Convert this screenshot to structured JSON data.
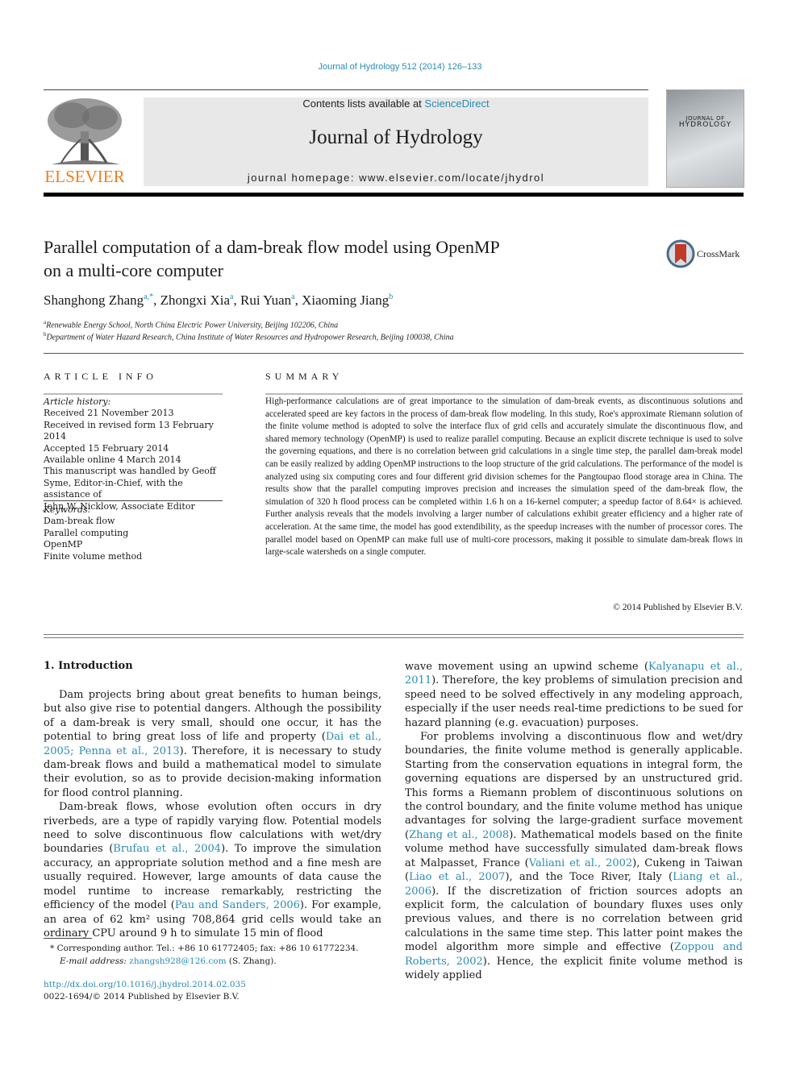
{
  "header": {
    "journal_ref": "Journal of Hydrology 512 (2014) 126–133",
    "contents_prefix": "Contents lists available at ",
    "contents_link": "ScienceDirect",
    "journal_title": "Journal of Hydrology",
    "homepage": "journal homepage: www.elsevier.com/locate/jhydrol",
    "publisher_logo_text": "ELSEVIER",
    "cover_line1": "JOURNAL OF",
    "cover_line2": "HYDROLOGY",
    "accent_color": "#2a8bb5",
    "publisher_color": "#f07f1e"
  },
  "article": {
    "title_line1": "Parallel computation of a dam-break flow model using OpenMP",
    "title_line2": "on a multi-core computer",
    "crossmark_label": "CrossMark",
    "authors": [
      {
        "name": "Shanghong Zhang",
        "sup": "a,*"
      },
      {
        "name": "Zhongxi Xia",
        "sup": "a"
      },
      {
        "name": "Rui Yuan",
        "sup": "a"
      },
      {
        "name": "Xiaoming Jiang",
        "sup": "b"
      }
    ],
    "affiliations": [
      {
        "sup": "a",
        "text": "Renewable Energy School, North China Electric Power University, Beijing 102206, China"
      },
      {
        "sup": "b",
        "text": "Department of Water Hazard Research, China Institute of Water Resources and Hydropower Research, Beijing 100038, China"
      }
    ]
  },
  "article_info": {
    "heading": "ARTICLE INFO",
    "history_label": "Article history:",
    "history": [
      "Received 21 November 2013",
      "Received in revised form 13 February 2014",
      "Accepted 15 February 2014",
      "Available online 4 March 2014",
      "This manuscript was handled by Geoff",
      "Syme, Editor-in-Chief, with the assistance of",
      "John W. Nicklow, Associate Editor"
    ],
    "keywords_label": "Keywords:",
    "keywords": [
      "Dam-break flow",
      "Parallel computing",
      "OpenMP",
      "Finite volume method"
    ]
  },
  "summary": {
    "heading": "SUMMARY",
    "text": "High-performance calculations are of great importance to the simulation of dam-break events, as discontinuous solutions and accelerated speed are key factors in the process of dam-break flow modeling. In this study, Roe's approximate Riemann solution of the finite volume method is adopted to solve the interface flux of grid cells and accurately simulate the discontinuous flow, and shared memory technology (OpenMP) is used to realize parallel computing. Because an explicit discrete technique is used to solve the governing equations, and there is no correlation between grid calculations in a single time step, the parallel dam-break model can be easily realized by adding OpenMP instructions to the loop structure of the grid calculations. The performance of the model is analyzed using six computing cores and four different grid division schemes for the Pangtoupao flood storage area in China. The results show that the parallel computing improves precision and increases the simulation speed of the dam-break flow, the simulation of 320 h flood process can be completed within 1.6 h on a 16-kernel computer; a speedup factor of 8.64× is achieved. Further analysis reveals that the models involving a larger number of calculations exhibit greater efficiency and a higher rate of acceleration. At the same time, the model has good extendibility, as the speedup increases with the number of processor cores. The parallel model based on OpenMP can make full use of multi-core processors, making it possible to simulate dam-break flows in large-scale watersheds on a single computer.",
    "copyright": "© 2014 Published by Elsevier B.V."
  },
  "body": {
    "section_heading": "1. Introduction",
    "left_p1": [
      {
        "t": "Dam projects bring about great benefits to human beings, but also give rise to potential dangers. Although the possibility of a dam-break is very small, should one occur, it has the potential to bring great loss of life and property ("
      },
      {
        "t": "Dai et al., 2005; Penna et al., 2013",
        "link": true
      },
      {
        "t": "). Therefore, it is necessary to study dam-break flows and build a mathematical model to simulate their evolution, so as to provide decision-making information for flood control planning."
      }
    ],
    "left_p2": [
      {
        "t": "Dam-break flows, whose evolution often occurs in dry riverbeds, are a type of rapidly varying flow. Potential models need to solve discontinuous flow calculations with wet/dry boundaries ("
      },
      {
        "t": "Brufau et al., 2004",
        "link": true
      },
      {
        "t": "). To improve the simulation accuracy, an appropriate solution method and a fine mesh are usually required. However, large amounts of data cause the model runtime to increase remarkably, restricting the efficiency of the model ("
      },
      {
        "t": "Pau and Sanders, 2006",
        "link": true
      },
      {
        "t": "). For example, an area of 62 km² using 708,864 grid cells would take an ordinary CPU around 9 h to simulate 15 min of flood"
      }
    ],
    "right_p1": [
      {
        "t": "wave movement using an upwind scheme ("
      },
      {
        "t": "Kalyanapu et al., 2011",
        "link": true
      },
      {
        "t": "). Therefore, the key problems of simulation precision and speed need to be solved effectively in any modeling approach, especially if the user needs real-time predictions to be sued for hazard planning (e.g. evacuation) purposes."
      }
    ],
    "right_p2": [
      {
        "t": "For problems involving a discontinuous flow and wet/dry boundaries, the finite volume method is generally applicable. Starting from the conservation equations in integral form, the governing equations are dispersed by an unstructured grid. This forms a Riemann problem of discontinuous solutions on the control boundary, and the finite volume method has unique advantages for solving the large-gradient surface movement ("
      },
      {
        "t": "Zhang et al., 2008",
        "link": true
      },
      {
        "t": "). Mathematical models based on the finite volume method have successfully simulated dam-break flows at Malpasset, France ("
      },
      {
        "t": "Valiani et al., 2002",
        "link": true
      },
      {
        "t": "), Cukeng in Taiwan ("
      },
      {
        "t": "Liao et al., 2007",
        "link": true
      },
      {
        "t": "), and the Toce River, Italy ("
      },
      {
        "t": "Liang et al., 2006",
        "link": true
      },
      {
        "t": "). If the discretization of friction sources adopts an explicit form, the calculation of boundary fluxes uses only previous values, and there is no correlation between grid calculations in the same time step. This latter point makes the model algorithm more simple and effective ("
      },
      {
        "t": "Zoppou and Roberts, 2002",
        "link": true
      },
      {
        "t": "). Hence, the explicit finite volume method is widely applied"
      }
    ]
  },
  "footnotes": {
    "corresponding": "* Corresponding author. Tel.: +86 10 61772405; fax: +86 10 61772234.",
    "email_label": "E-mail address: ",
    "email": "zhangsh928@126.com",
    "email_suffix": " (S. Zhang).",
    "doi": "http://dx.doi.org/10.1016/j.jhydrol.2014.02.035",
    "issn": "0022-1694/© 2014 Published by Elsevier B.V."
  }
}
